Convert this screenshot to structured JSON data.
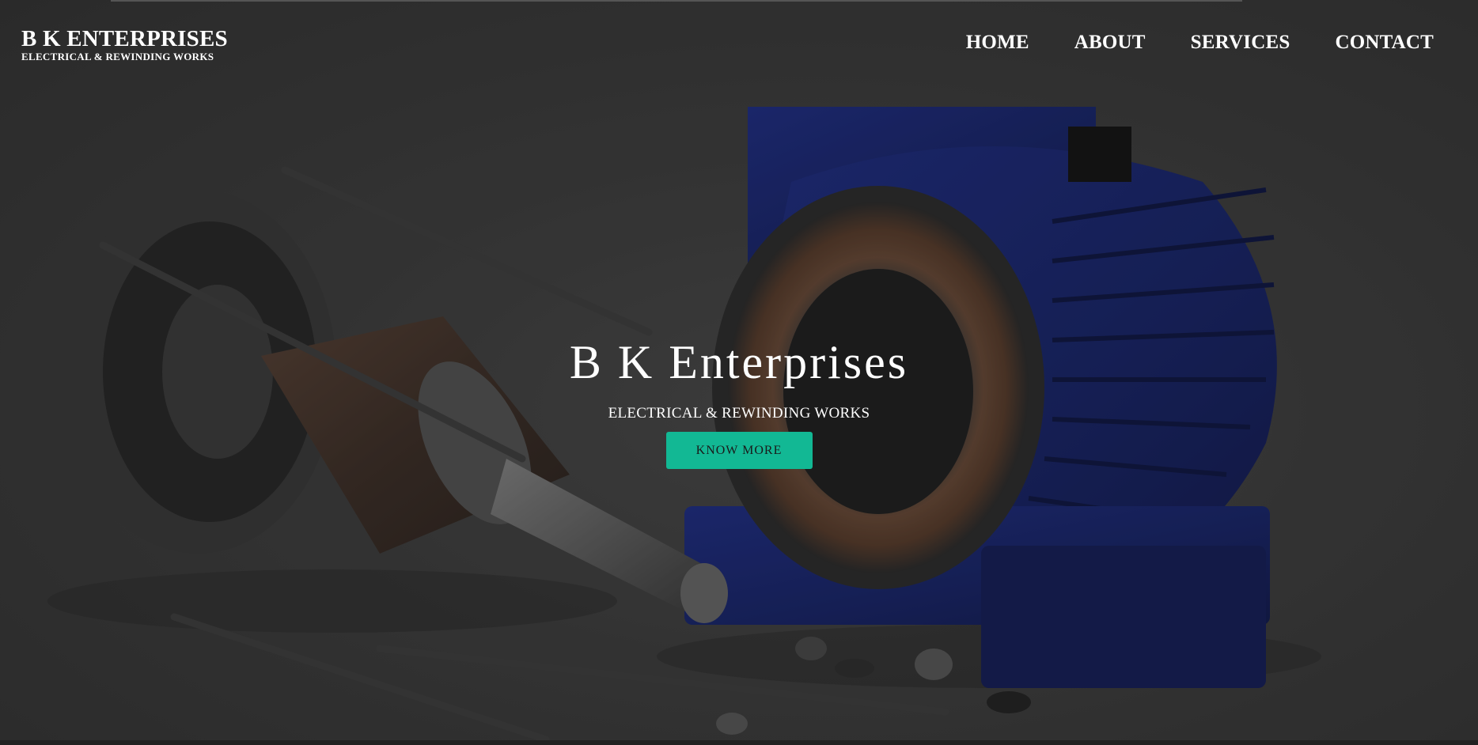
{
  "brand": {
    "title": "B K ENTERPRISES",
    "subtitle": "ELECTRICAL & REWINDING WORKS"
  },
  "nav": {
    "items": [
      {
        "label": "HOME"
      },
      {
        "label": "ABOUT"
      },
      {
        "label": "SERVICES"
      },
      {
        "label": "CONTACT"
      }
    ]
  },
  "hero": {
    "title": "B K Enterprises",
    "subtitle": "ELECTRICAL & REWINDING WORKS",
    "button_label": "KNOW MORE",
    "button_color": "#12b894",
    "background_image": "disassembled-electric-motor"
  }
}
